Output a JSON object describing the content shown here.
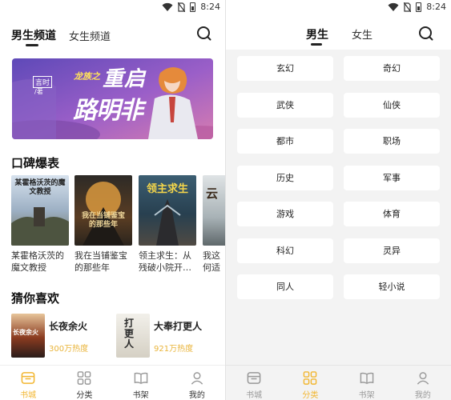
{
  "status_bar": {
    "time": "8:24"
  },
  "left": {
    "tabs": [
      {
        "label": "男生频道"
      },
      {
        "label": "女生频道"
      }
    ],
    "banner": {
      "title_top": "龙族之",
      "title_main": "重启",
      "title_sub": "路明非",
      "author_badge": "言时",
      "author_note": "/著"
    },
    "section_popular": "口碑爆表",
    "books": [
      {
        "title": "某霍格沃茨的魔文教授",
        "cover_text": "某霍格沃茨的魔文教授"
      },
      {
        "title": "我在当铺鉴宝的那些年",
        "cover_text": "我在当铺鉴宝的那些年"
      },
      {
        "title": "领主求生：从残破小院开…",
        "cover_text": "领主求生"
      },
      {
        "title": "我这何适",
        "cover_text": "云"
      }
    ],
    "section_guess": "猜你喜欢",
    "guess": [
      {
        "title": "长夜余火",
        "heat": "300万热度",
        "cover_text": "长夜余火"
      },
      {
        "title": "大奉打更人",
        "heat": "921万热度",
        "cover_text": "打更人"
      }
    ],
    "nav": [
      {
        "label": "书城",
        "icon": "bookstore-icon",
        "active": true
      },
      {
        "label": "分类",
        "icon": "grid-icon",
        "active": false
      },
      {
        "label": "书架",
        "icon": "book-icon",
        "active": false
      },
      {
        "label": "我的",
        "icon": "person-icon",
        "active": false
      }
    ]
  },
  "right": {
    "tabs": [
      {
        "label": "男生"
      },
      {
        "label": "女生"
      }
    ],
    "categories": [
      "玄幻",
      "奇幻",
      "武侠",
      "仙侠",
      "都市",
      "职场",
      "历史",
      "军事",
      "游戏",
      "体育",
      "科幻",
      "灵异",
      "同人",
      "轻小说"
    ],
    "nav": [
      {
        "label": "书城",
        "icon": "bookstore-icon",
        "active": false
      },
      {
        "label": "分类",
        "icon": "grid-icon",
        "active": true
      },
      {
        "label": "书架",
        "icon": "book-icon",
        "active": false
      },
      {
        "label": "我的",
        "icon": "person-icon",
        "active": false
      }
    ]
  },
  "colors": {
    "accent": "#f2b630",
    "inactive": "#999999",
    "panel_bg": "#f3f3f3"
  }
}
